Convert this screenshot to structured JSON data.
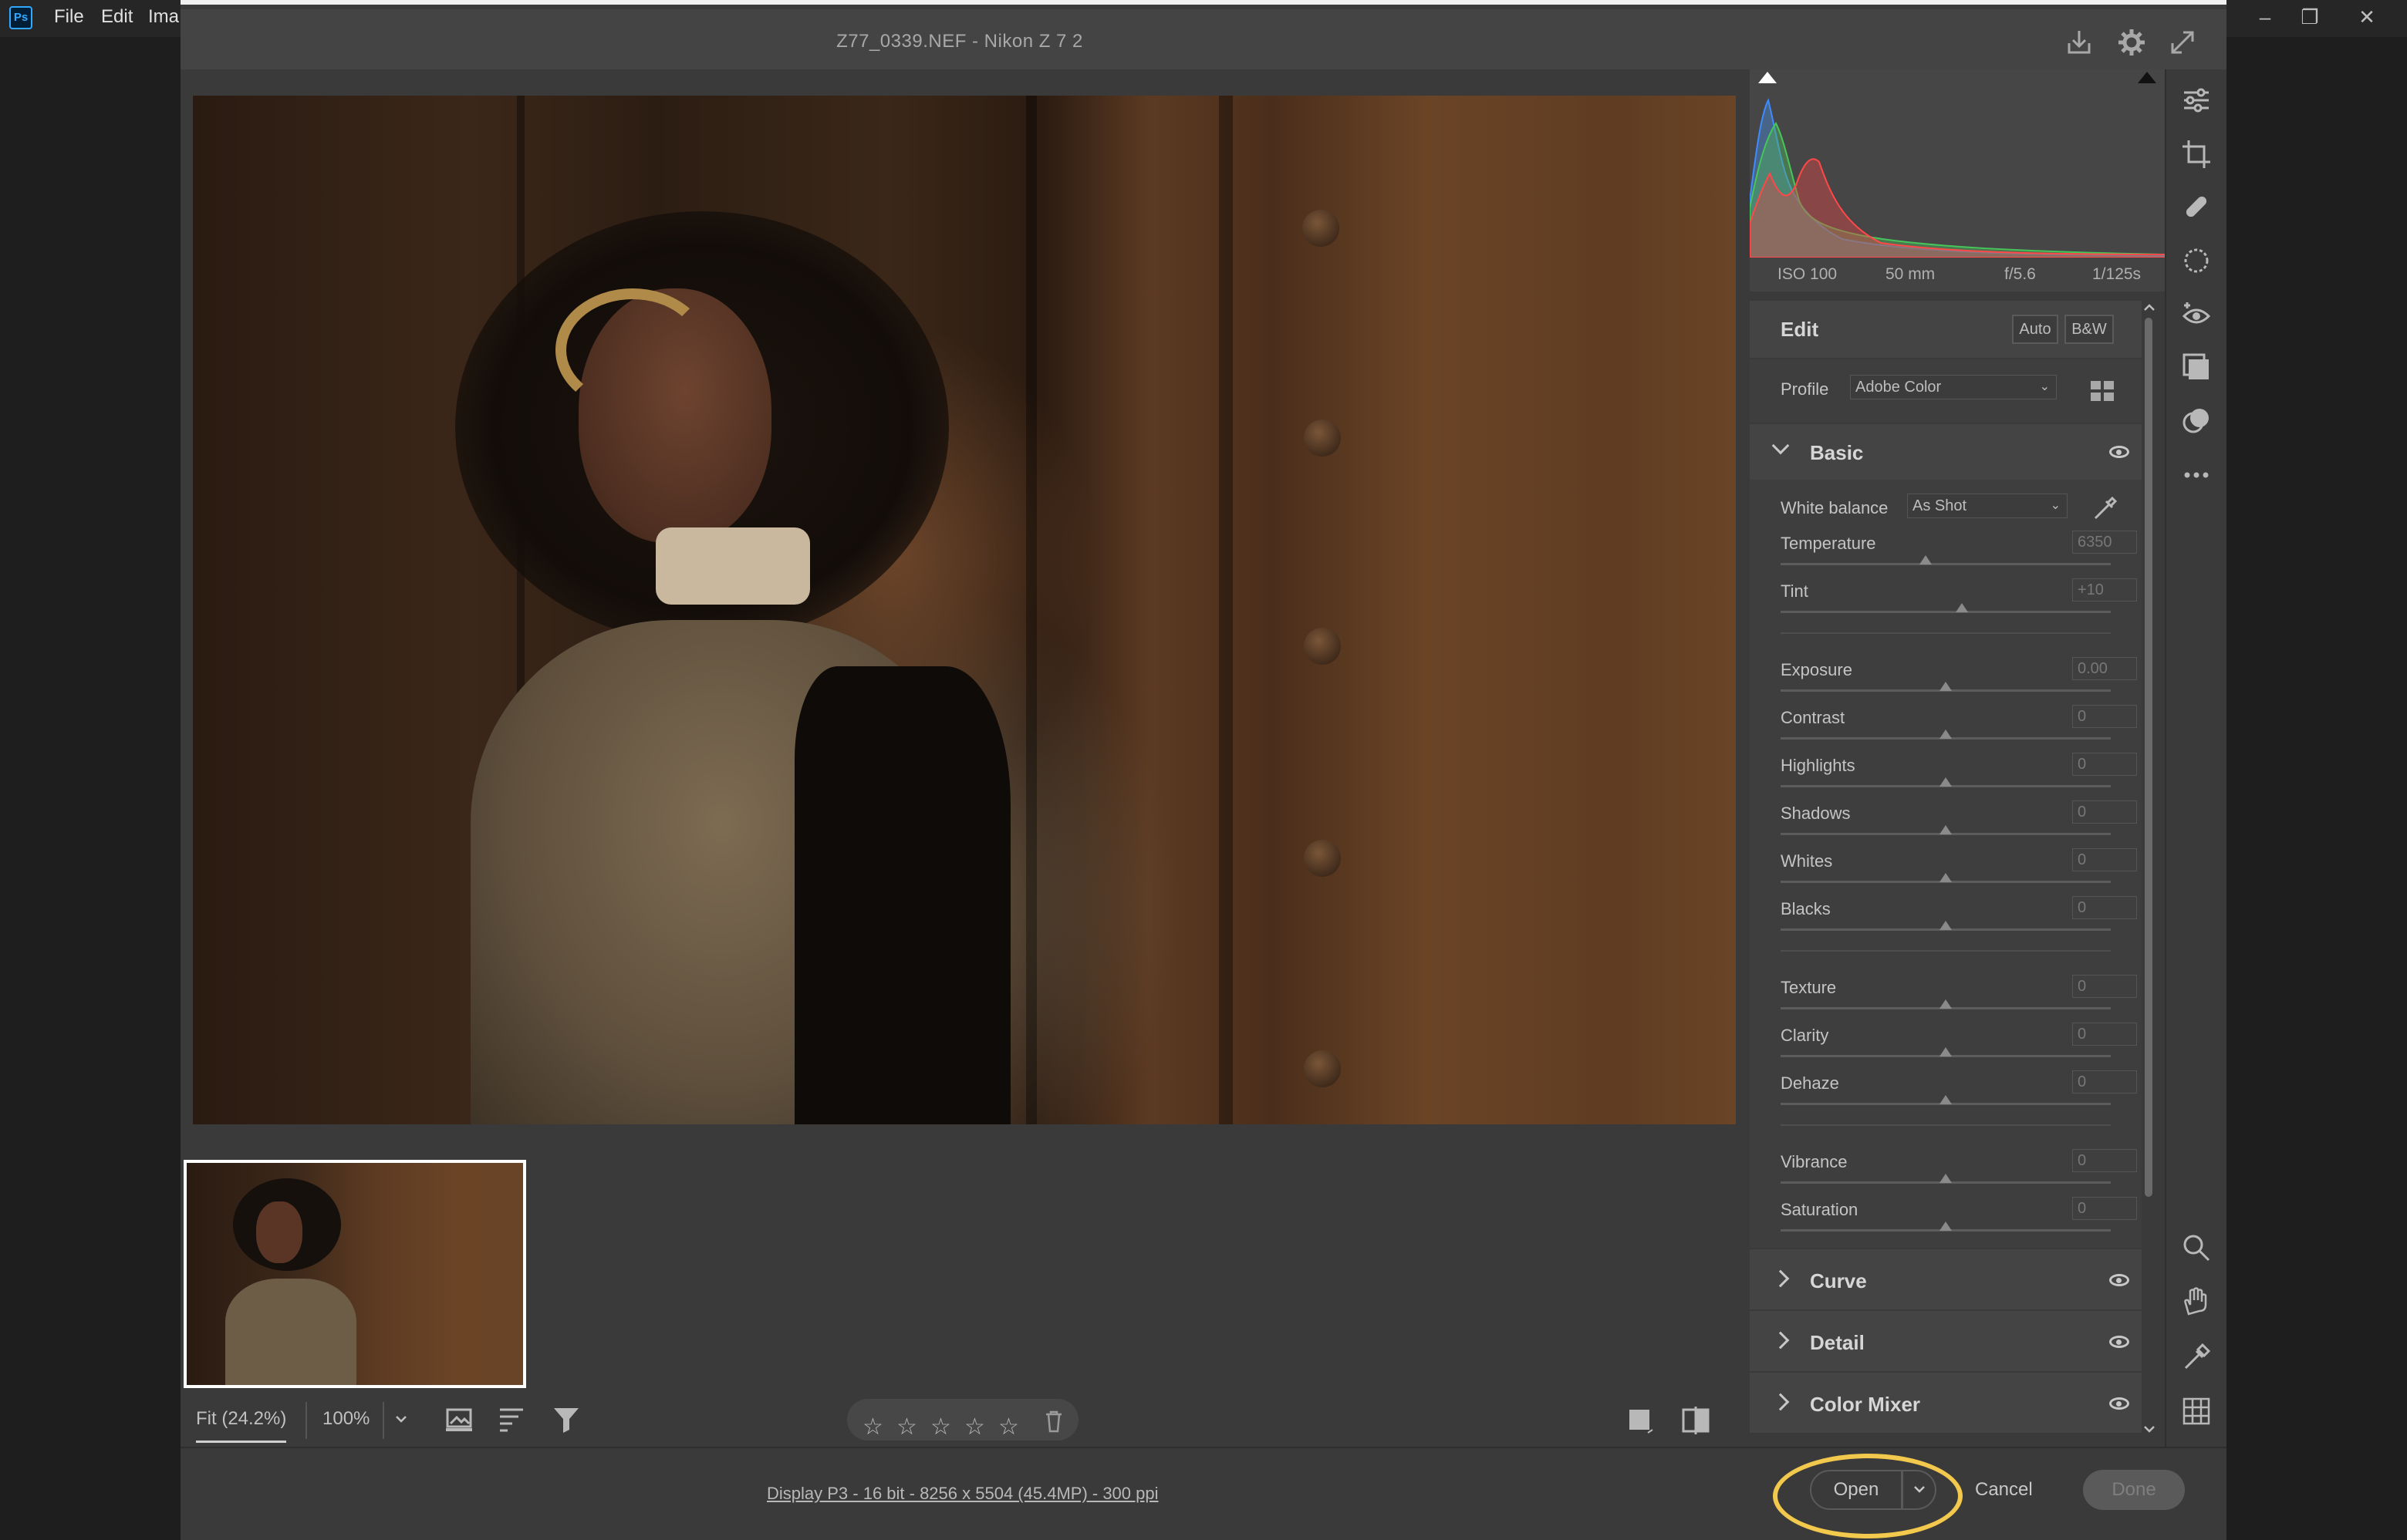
{
  "ps": {
    "logo": "Ps",
    "menus": [
      "File",
      "Edit",
      "Ima"
    ],
    "window_controls": [
      "–",
      "❐",
      "✕"
    ]
  },
  "dialog": {
    "title": "Z77_0339.NEF  -  Nikon Z 7 2",
    "title_icons": [
      "save-icon",
      "gear-icon",
      "fullscreen-icon"
    ]
  },
  "histogram": {
    "exif": [
      "ISO 100",
      "50 mm",
      "f/5.6",
      "1/125s"
    ]
  },
  "edit": {
    "title": "Edit",
    "auto_label": "Auto",
    "bw_label": "B&W",
    "profile_label": "Profile",
    "profile_value": "Adobe Color"
  },
  "basic": {
    "title": "Basic",
    "white_balance_label": "White balance",
    "white_balance_value": "As Shot",
    "groups": [
      [
        {
          "label": "Temperature",
          "value": "6350",
          "pos": 0.44
        },
        {
          "label": "Tint",
          "value": "+10",
          "pos": 0.55
        }
      ],
      [
        {
          "label": "Exposure",
          "value": "0.00",
          "pos": 0.5
        },
        {
          "label": "Contrast",
          "value": "0",
          "pos": 0.5
        },
        {
          "label": "Highlights",
          "value": "0",
          "pos": 0.5
        },
        {
          "label": "Shadows",
          "value": "0",
          "pos": 0.5
        },
        {
          "label": "Whites",
          "value": "0",
          "pos": 0.5
        },
        {
          "label": "Blacks",
          "value": "0",
          "pos": 0.5
        }
      ],
      [
        {
          "label": "Texture",
          "value": "0",
          "pos": 0.5
        },
        {
          "label": "Clarity",
          "value": "0",
          "pos": 0.5
        },
        {
          "label": "Dehaze",
          "value": "0",
          "pos": 0.5
        }
      ],
      [
        {
          "label": "Vibrance",
          "value": "0",
          "pos": 0.5
        },
        {
          "label": "Saturation",
          "value": "0",
          "pos": 0.5
        }
      ]
    ]
  },
  "collapsed_sections": [
    "Curve",
    "Detail",
    "Color Mixer"
  ],
  "bottombar": {
    "fit_label": "Fit (24.2%)",
    "zoom_label": "100%",
    "stars": 5
  },
  "footer": {
    "workflow_text": "Display P3 - 16 bit - 8256 x 5504 (45.4MP) - 300 ppi",
    "open_label": "Open",
    "cancel_label": "Cancel",
    "done_label": "Done",
    "highlight_color": "#f2c94c"
  }
}
